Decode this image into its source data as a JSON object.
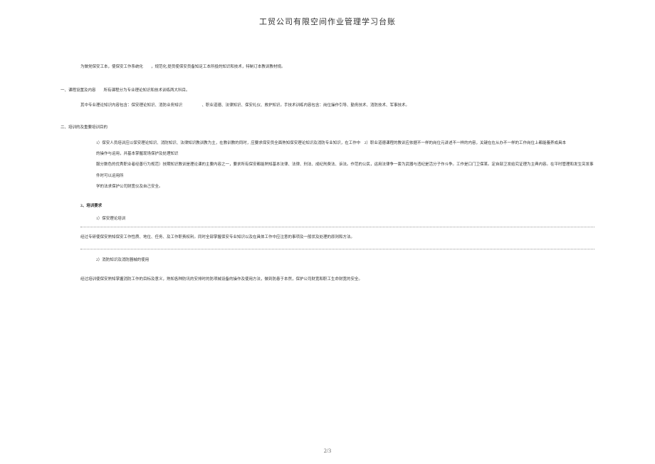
{
  "title": "工贸公司有限空间作业管理学习台账",
  "intro_line": "为做党保安工本，使保安工作系统化　　，规范化,提员使保安员备知足工本所投的知识和技术，特制订本教训教材规。",
  "section1_heading": "一、课程设置及内容　　所有课程分为专业理论知识和技术训练两大科目。",
  "section1_body": "其中专业理论知识内容包含：保安理论知识、消防业务知识　　　　　、职业道德、法律知识、保安礼仪、救护知识。手技术训练内容包含：岗位操作引导、勤务技术、消防技术、军事技术。",
  "section2_heading": "二、培训的及重要培训目的",
  "section2_item1_left": "1）保安人员培训应以保安理论知识、消防知识、法律知识教训教为主，在教训教的同时，应要求保安员全面熟知保安理论知识及消防专业知识，在工作中的操作与运用，并基本掌握现场保护及处理知识",
  "section2_item1_right": "2）职业道德课程的教训应依据不一样的岗位元讲述不一样的内容，关键在在从办不一样的工作岗位上都能養养成具本",
  "section2_item2": "服分数色的优秀职业者经善行为规范）技期知识教训是理论课的主要内容之一，要求所有保安都能熟知基本法律、法律、刑法、成纪刑费法、诉法。作范的公民，运用法律争一套为武器与违纪是活分子作斗争。工作是口门卫保某。定自部卫发给究证理为主典内容。在平时管理和发生突发事件时可以运用所",
  "section2_item3": "学的法求保护公司财宽仪及自己安全。",
  "section3_heading": "2、培训要求",
  "section3_item1": "1）保安理论培训",
  "section3_body1": "经过专研使保安熟知保安工作性质、地位、任务、及工作职责权利。同时全部掌握保安专业知识以及在具体工作中应注意的事项及一般状及处理的原则和方法。",
  "section3_item2": "2）消防知识及消防器械的使用",
  "section3_body2": "经过培训使保安熟知掌握消防工作的目标及意义，熟知各种防讯的安排时的防项械设备的操作及使用方法，做到防患于本然，保护公司财宽和职工生命财宽的安全。",
  "page_number": "2/3"
}
